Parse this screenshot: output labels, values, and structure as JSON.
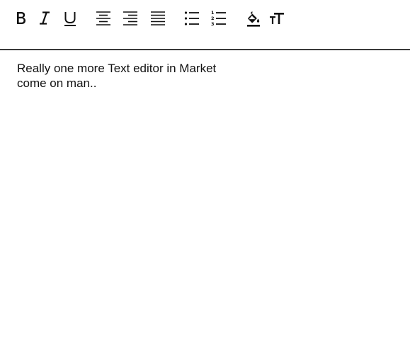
{
  "toolbar": {
    "buttons": [
      {
        "name": "bold",
        "icon": "bold-icon"
      },
      {
        "name": "italic",
        "icon": "italic-icon"
      },
      {
        "name": "underline",
        "icon": "underline-icon"
      },
      {
        "name": "align-center",
        "icon": "align-center-icon"
      },
      {
        "name": "align-right",
        "icon": "align-right-icon"
      },
      {
        "name": "align-justify",
        "icon": "align-justify-icon"
      },
      {
        "name": "bullet-list",
        "icon": "bullet-list-icon"
      },
      {
        "name": "numbered-list",
        "icon": "numbered-list-icon"
      },
      {
        "name": "fill-color",
        "icon": "paint-bucket-icon"
      },
      {
        "name": "text-size",
        "icon": "text-size-icon"
      }
    ]
  },
  "editor": {
    "lines": [
      "Really one more Text editor in Market",
      "come on man.."
    ]
  },
  "colors": {
    "text": "#111111",
    "divider": "#3a3a3a",
    "background": "#ffffff"
  }
}
